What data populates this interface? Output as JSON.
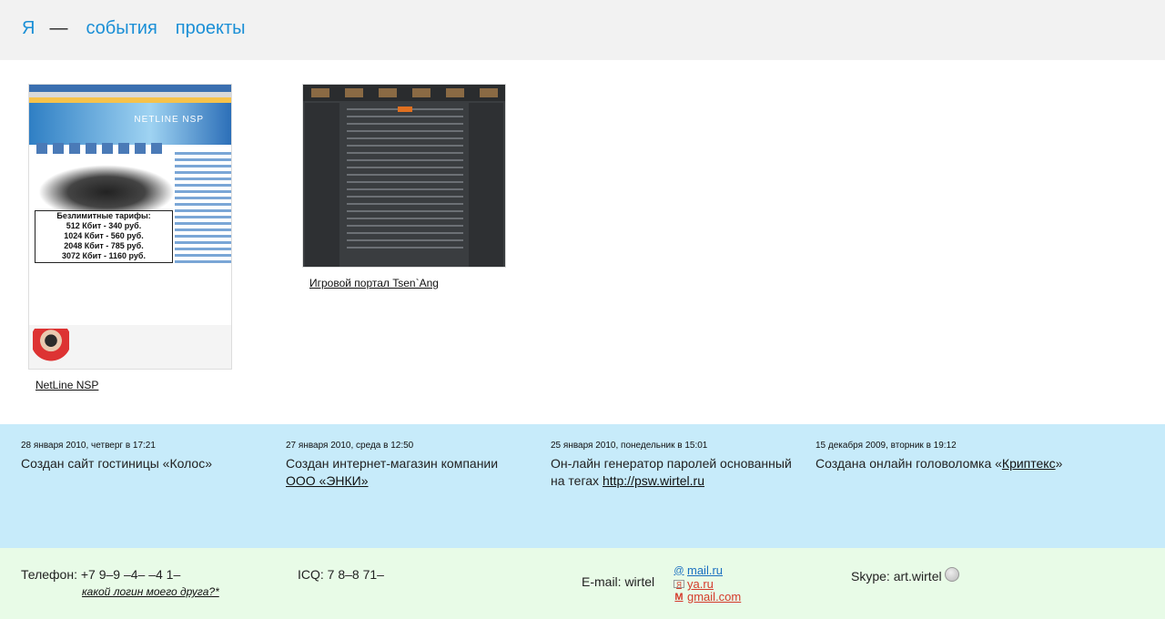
{
  "nav": {
    "me": "Я",
    "dash": "—",
    "events": "события",
    "projects": "проекты"
  },
  "projects": [
    {
      "title": "NetLine NSP",
      "banner": "NETLINE NSP",
      "tariffs_title": "Безлимитные тарифы:",
      "tariffs": [
        "512 Кбит  -   340 руб.",
        "1024 Кбит  -   560 руб.",
        "2048 Кбит  -   785 руб.",
        "3072 Кбит  -  1160 руб."
      ]
    },
    {
      "title": "Игровой портал Tsen`Ang"
    }
  ],
  "events": [
    {
      "date": "28 января 2010, четверг в 17:21",
      "text": "Создан сайт гостиницы «Колос»"
    },
    {
      "date": "27 января 2010, среда в 12:50",
      "text": "Создан интернет-магазин компании",
      "link": "ООО «ЭНКИ»"
    },
    {
      "date": "25 января 2010, понедельник в 15:01",
      "text": "Он-лайн генератор паролей основанный на тегах",
      "link": "http://psw.wirtel.ru"
    },
    {
      "date": "15 декабря 2009, вторник в 19:12",
      "text": "Создана онлайн головоломка «",
      "link": "Криптекс",
      "tail": "»"
    }
  ],
  "contacts": {
    "phone": "Телефон: +7 9–9 –4– –4 1–",
    "friend_link": "какой логин моего друга?*",
    "icq": "ICQ: 7 8–8 71–",
    "email_label": "E-mail: wirtel",
    "mail_ru": "mail.ru",
    "ya_ru": "ya.ru",
    "gmail": "gmail.com",
    "skype": "Skype: art.wirtel"
  },
  "colors": {
    "link": "#1a8fd6",
    "events_bg": "#c7ebfa",
    "contacts_bg": "#e8fbe7",
    "header_bg": "#f2f2f2"
  }
}
